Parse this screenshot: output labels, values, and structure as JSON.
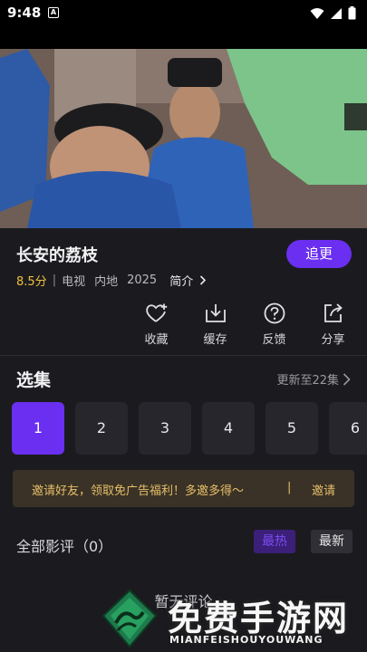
{
  "status": {
    "time": "9:48",
    "notif_letter": "A"
  },
  "video": {
    "progress": 0.14
  },
  "show": {
    "title": "长安的荔枝",
    "follow_label": "追更",
    "score": "8.5分",
    "separator": "|",
    "genre": "电视",
    "region": "内地",
    "year": "2025",
    "intro_label": "简介"
  },
  "actions": [
    {
      "label": "收藏",
      "icon": "heart-plus-icon"
    },
    {
      "label": "缓存",
      "icon": "download-icon"
    },
    {
      "label": "反馈",
      "icon": "question-icon"
    },
    {
      "label": "分享",
      "icon": "share-icon"
    }
  ],
  "episodes": {
    "title": "选集",
    "more_label": "更新至22集",
    "items": [
      "1",
      "2",
      "3",
      "4",
      "5",
      "6"
    ],
    "selected": "1"
  },
  "invite": {
    "text": "邀请好友，领取免广告福利！多邀多得～",
    "separator": "|",
    "link": "邀请"
  },
  "reviews": {
    "title": "全部影评（0）",
    "hot_label": "最热",
    "new_label": "最新",
    "empty_text": "暂无评论"
  },
  "watermark": {
    "title": "免费手游网",
    "subtitle": "MIANFEISHOUYOUWANG"
  },
  "colors": {
    "accent": "#6a2ff0",
    "score": "#f0c040",
    "invite_text": "#e6bf6a"
  }
}
